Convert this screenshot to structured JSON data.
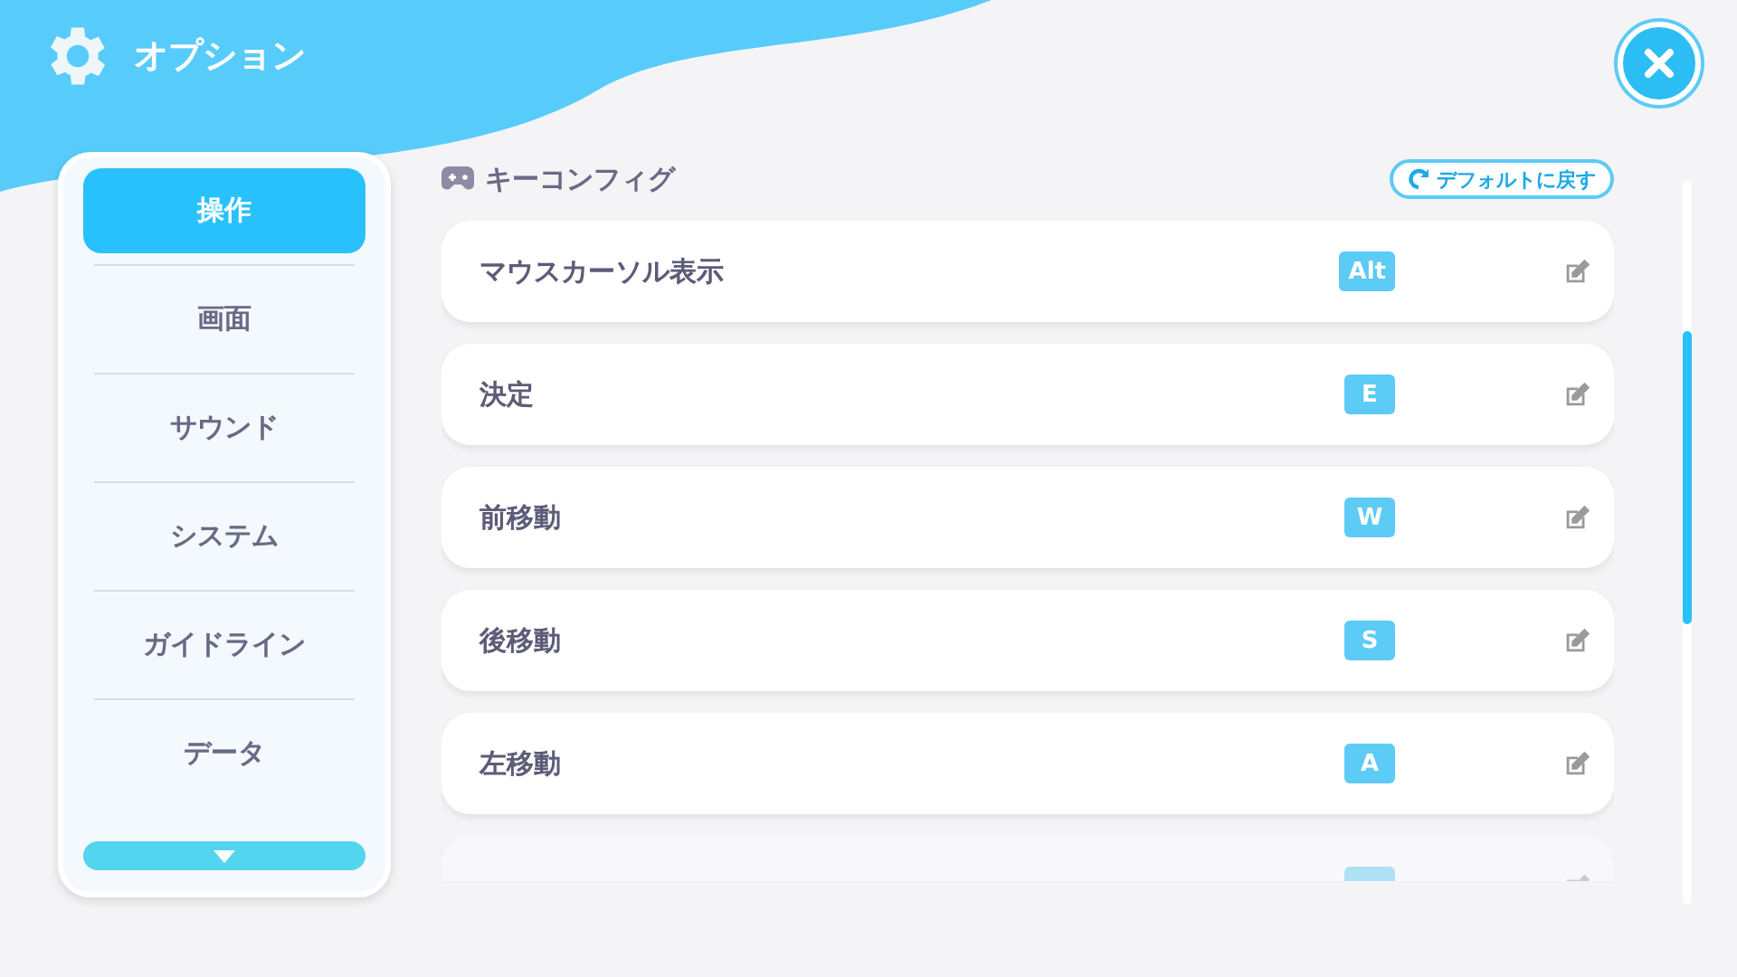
{
  "header": {
    "title": "オプション"
  },
  "sidebar": {
    "items": [
      {
        "label": "操作",
        "selected": true
      },
      {
        "label": "画面",
        "selected": false
      },
      {
        "label": "サウンド",
        "selected": false
      },
      {
        "label": "システム",
        "selected": false
      },
      {
        "label": "ガイドライン",
        "selected": false
      },
      {
        "label": "データ",
        "selected": false
      }
    ]
  },
  "section": {
    "title": "キーコンフィグ",
    "reset_button": "デフォルトに戻す"
  },
  "bindings": [
    {
      "action": "マウスカーソル表示",
      "key": "Alt"
    },
    {
      "action": "決定",
      "key": "E"
    },
    {
      "action": "前移動",
      "key": "W"
    },
    {
      "action": "後移動",
      "key": "S"
    },
    {
      "action": "左移動",
      "key": "A"
    },
    {
      "kind": "partial"
    }
  ]
}
